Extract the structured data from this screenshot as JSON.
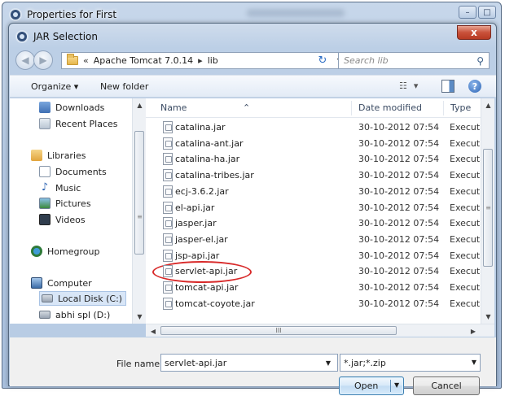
{
  "outer_window": {
    "title": "Properties for First",
    "minimize": "–",
    "maximize": "□"
  },
  "dialog": {
    "title": "JAR Selection",
    "close": "x"
  },
  "address_bar": {
    "overflow": "«",
    "segments": [
      "Apache Tomcat 7.0.14",
      "lib"
    ],
    "separator": "▸",
    "dropdown": "▼",
    "refresh": "↻"
  },
  "search": {
    "placeholder": "Search lib",
    "icon": "magnifier-icon",
    "glyph": "⚲"
  },
  "toolbar": {
    "organize": "Organize ▾",
    "new_folder": "New folder",
    "view_icon": "☷",
    "view_drop": "▾",
    "help": "?"
  },
  "nav_pane": {
    "items": [
      {
        "label": "Downloads",
        "icon": "downloads-icon"
      },
      {
        "label": "Recent Places",
        "icon": "recent-places-icon"
      },
      {
        "label": "Libraries",
        "icon": "libraries-icon"
      },
      {
        "label": "Documents",
        "icon": "documents-icon"
      },
      {
        "label": "Music",
        "icon": "music-icon"
      },
      {
        "label": "Pictures",
        "icon": "pictures-icon"
      },
      {
        "label": "Videos",
        "icon": "videos-icon"
      },
      {
        "label": "Homegroup",
        "icon": "homegroup-icon"
      },
      {
        "label": "Computer",
        "icon": "computer-icon"
      },
      {
        "label": "Local Disk (C:)",
        "icon": "disk-icon",
        "selected": true
      },
      {
        "label": "abhi spl (D:)",
        "icon": "disk-icon"
      }
    ]
  },
  "file_list": {
    "columns": [
      "Name",
      "Date modified",
      "Type"
    ],
    "rows": [
      {
        "name": "catalina.jar",
        "date": "30-10-2012 07:54",
        "type": "Executabl"
      },
      {
        "name": "catalina-ant.jar",
        "date": "30-10-2012 07:54",
        "type": "Executabl"
      },
      {
        "name": "catalina-ha.jar",
        "date": "30-10-2012 07:54",
        "type": "Executabl"
      },
      {
        "name": "catalina-tribes.jar",
        "date": "30-10-2012 07:54",
        "type": "Executabl"
      },
      {
        "name": "ecj-3.6.2.jar",
        "date": "30-10-2012 07:54",
        "type": "Executabl"
      },
      {
        "name": "el-api.jar",
        "date": "30-10-2012 07:54",
        "type": "Executabl"
      },
      {
        "name": "jasper.jar",
        "date": "30-10-2012 07:54",
        "type": "Executabl"
      },
      {
        "name": "jasper-el.jar",
        "date": "30-10-2012 07:54",
        "type": "Executabl"
      },
      {
        "name": "jsp-api.jar",
        "date": "30-10-2012 07:54",
        "type": "Executabl"
      },
      {
        "name": "servlet-api.jar",
        "date": "30-10-2012 07:54",
        "type": "Executabl",
        "highlighted": true
      },
      {
        "name": "tomcat-api.jar",
        "date": "30-10-2012 07:54",
        "type": "Executabl"
      },
      {
        "name": "tomcat-coyote.jar",
        "date": "30-10-2012 07:54",
        "type": "Executabl"
      }
    ]
  },
  "scroll": {
    "up": "▲",
    "down": "▼",
    "left": "◀",
    "right": "▶",
    "grip": "III",
    "vgrip": "≡"
  },
  "bottom": {
    "file_name_label": "File name:",
    "file_name_value": "servlet-api.jar",
    "file_type_value": "*.jar;*.zip",
    "open_label": "Open",
    "cancel_label": "Cancel",
    "dropdown": "▼"
  },
  "colors": {
    "highlight_circle": "#d82a2a",
    "accent": "#3c7fb1"
  }
}
